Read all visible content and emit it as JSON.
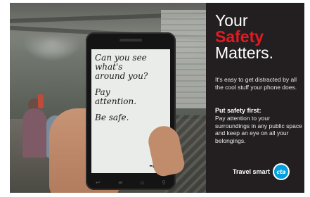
{
  "phone_screen": {
    "lines": [
      "Can you see",
      "what's",
      "around you?"
    ],
    "lines2": [
      "Pay",
      "attention."
    ],
    "line3": "Be safe.",
    "signature": "-cta"
  },
  "panel": {
    "headline": [
      "Your",
      "Safety",
      "Matters."
    ],
    "intro": "It's easy to get distracted by all the cool stuff your phone does.",
    "tip_title": "Put safety first:",
    "tip_body": "Pay attention to your surroundings in any public space and keep an eye on all your belongings.",
    "slogan": "Travel smart",
    "logo_text": "cta"
  },
  "colors": {
    "panel_bg": "#231f20",
    "accent_red": "#e11b22",
    "cta_blue": "#00a1de"
  }
}
